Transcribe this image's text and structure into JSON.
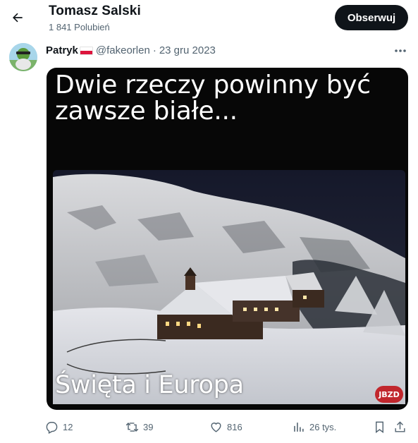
{
  "header": {
    "profile_name": "Tomasz Salski",
    "likes": "1 841 Polubień",
    "follow_label": "Obserwuj"
  },
  "tweet": {
    "author_name": "Patryk",
    "handle": "@fakeorlen",
    "separator": "·",
    "date": "23 gru 2023",
    "media": {
      "caption_top": "Dwie rzeczy powinny być zawsze białe...",
      "caption_bottom": "Święta i Europa",
      "watermark": "JBZD"
    },
    "actions": {
      "replies": "12",
      "reposts": "39",
      "likes": "816",
      "views": "26 tys."
    }
  },
  "icons": {
    "back": "arrow-left-icon",
    "more": "more-horizontal-icon",
    "reply": "reply-icon",
    "repost": "repost-icon",
    "like": "heart-icon",
    "views": "views-chart-icon",
    "bookmark": "bookmark-icon",
    "share": "share-icon"
  },
  "colors": {
    "text": "#0f1419",
    "secondary": "#536471",
    "follow_bg": "#0f1419",
    "flag_red": "#dc143c"
  }
}
